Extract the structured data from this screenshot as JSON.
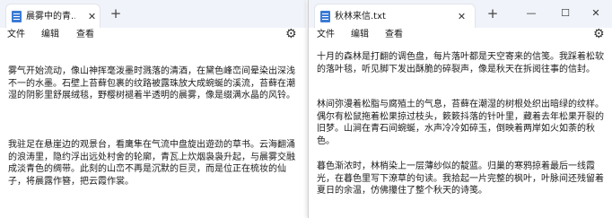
{
  "left_window": {
    "tab_title": "晨雾中的青…",
    "menu": [
      "文件",
      "编辑",
      "查看"
    ],
    "paragraphs": [
      "雾气开始流动，像山神挥毫泼墨时溅落的清酒，在黛色峰峦间晕染出深浅不一的水墨。石壁上苔藓包裹的纹路被露珠放大成蜿蜒的溪流，苔藓在潮湿的阴影里舒展绒毯，野樱树褪着半透明的晨雾，像是缀满水晶的风铃。",
      "我驻足在悬崖边的观景台，看鹰隼在气流中盘旋出遊劲的草书。云海翻涌的浪涛里，隐约浮出远处村舍的轮廓，青瓦上炊烟袅袅升起，与晨雾交融成淡青色的绸带。此刻的山峦不再是沉默的巨灵，而是位正在梳妆的仙子，将晨露作簪，把云霞作裳。"
    ]
  },
  "right_window": {
    "tab_title": "秋林来信.txt",
    "menu": [
      "文件",
      "编辑",
      "查看"
    ],
    "paragraphs": [
      "十月的森林是打翻的调色盘，每片落叶都是天空寄来的信笺。我踩着松软的落叶毯，听见脚下发出酥脆的碎裂声，像是秋天在拆阅往事的信封。",
      "林间弥漫着松脂与腐殖土的气息，苔藓在潮湿的树根处织出暗绿的纹样。偶尔有松鼠拖着松果掠过枝头，簌簌抖落的针叶里，藏着去年松果开裂的旧梦。山涧在青石间蜿蜒，水声冷冷如碎玉，倒映着两岸如火如荼的秋色。",
      "暮色渐浓时，林梢染上一层薄纱似的靛蓝。归巢的寒鸦掠着最后一线霞光，在暮色里写下潦草的句读。我拾起一片完整的枫叶，叶脉间还残留着夏日的余温，仿佛攥住了整个秋天的诗笺。"
    ]
  },
  "icons": {
    "app": "notepad-icon",
    "close_tab": "close-icon",
    "new_tab": "plus-icon",
    "minimize": "minimize-icon",
    "maximize": "maximize-icon",
    "close_window": "close-window-icon",
    "settings": "gear-icon"
  },
  "glyphs": {
    "close_tab": "✕",
    "new_tab": "+",
    "minimize": "—",
    "maximize": "☐",
    "close_window": "✕",
    "settings": "⚙"
  },
  "colors": {
    "titlebar": "#f0f3f9",
    "accent": "#3b7bd6",
    "text": "#1a1a1a"
  }
}
